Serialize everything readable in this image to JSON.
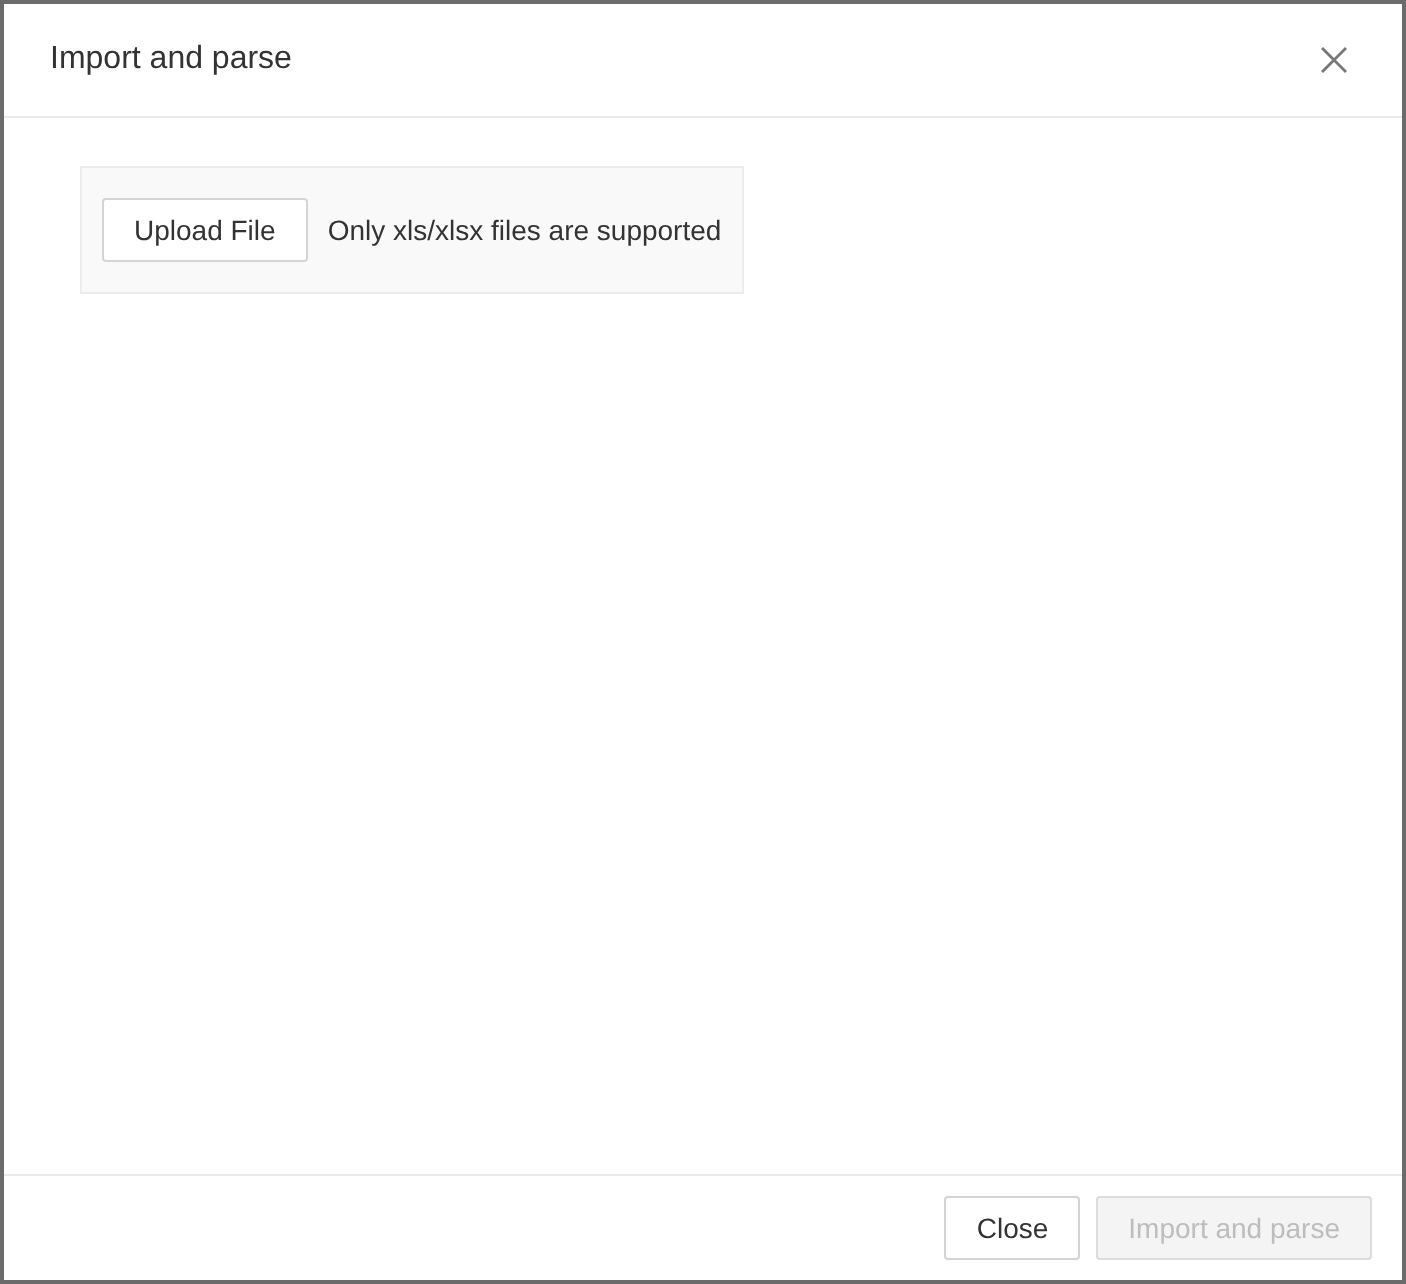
{
  "dialog": {
    "title": "Import and parse"
  },
  "upload": {
    "button": "Upload File",
    "hint": "Only xls/xlsx files are supported"
  },
  "footer": {
    "buttons": [
      {
        "label": "Close",
        "disabled": false
      },
      {
        "label": "Import and parse",
        "disabled": true
      }
    ]
  }
}
